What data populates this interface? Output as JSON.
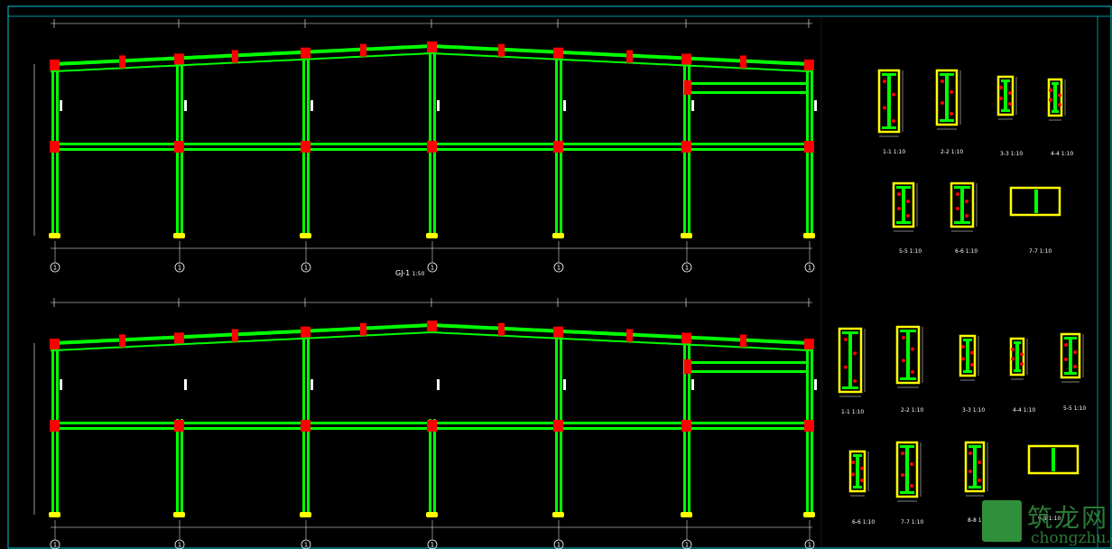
{
  "drawing": {
    "frame1_label": "GJ-1",
    "frame1_scale": "1:50",
    "axis_marks": [
      "①",
      "①",
      "①",
      "①",
      "①",
      "①",
      "①"
    ],
    "section_labels_top": [
      "1-1",
      "2-2",
      "3-3",
      "4-4",
      "5-5",
      "6-6",
      "7-7"
    ],
    "section_labels_bottom": [
      "1-1",
      "2-2",
      "3-3",
      "4-4",
      "5-5",
      "6-6",
      "7-7",
      "8-8",
      "9-9"
    ],
    "scale_suffix": "1:10"
  },
  "watermark": {
    "chinese": "筑龙网",
    "latin": "chongzhu.cn"
  },
  "colors": {
    "background": "#000000",
    "member": "#00ff00",
    "joint": "#ff0000",
    "base": "#ffff00",
    "dimension": "#ffffff",
    "frame_border": "#00c8d8",
    "section_box": "#ffff00",
    "section_fill": "#00ff00"
  }
}
